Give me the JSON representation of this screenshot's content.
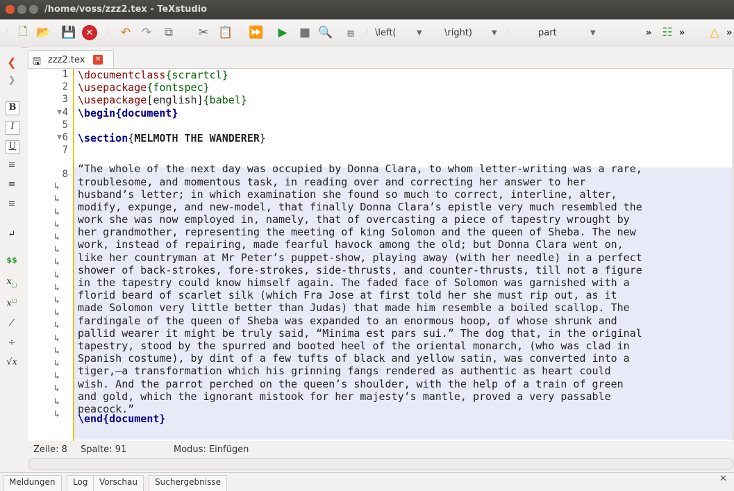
{
  "window": {
    "title": "/home/voss/zzz2.tex - TeXstudio"
  },
  "toolbar": {
    "left_delim": "\\left(",
    "right_delim": "\\right)",
    "structure_select": "part",
    "overflow": "»"
  },
  "tab": {
    "filename": "zzz2.tex"
  },
  "side_icons": {
    "bold": "B",
    "italic": "I",
    "underline": "U",
    "math": "$$"
  },
  "editor": {
    "line_numbers": [
      "1",
      "2",
      "3",
      "4",
      "5",
      "6",
      "7",
      "8"
    ],
    "line8_paragraph": [
      "“The whole of the next day was occupied by Donna Clara, to whom letter-writing was a rare,",
      "troublesome, and momentous task, in reading over and correcting her answer to her",
      "husband’s letter; in which examination she found so much to correct, interline, alter,",
      "modify, expunge, and new-model, that finally Donna Clara’s epistle very much resembled the",
      "work she was now employed in, namely, that of overcasting a piece of tapestry wrought by",
      "her grandmother, representing the meeting of king Solomon and the queen of Sheba. The new",
      "work, instead of repairing, made fearful havock among the old; but Donna Clara went on,",
      "like her countryman at Mr Peter’s puppet-show, playing away (with her needle) in a perfect",
      "shower of back-strokes, fore-strokes, side-thrusts, and counter-thrusts, till not a figure",
      "in the tapestry could know himself again. The faded face of Solomon was garnished with a",
      "florid beard of scarlet silk (which Fra Jose at first told her she must rip out, as it",
      "made Solomon very little better than Judas) that made him resemble a boiled scallop. The",
      "fardingale of the queen of Sheba was expanded to an enormous hoop, of whose shrunk and",
      "pallid wearer it might be truly said, “Minima est pars sui.” The dog that, in the original",
      "tapestry, stood by the spurred and booted heel of the oriental monarch, (who was clad in",
      "Spanish costume), by dint of a few tufts of black and yellow satin, was converted into a",
      "tiger,—a transformation which his grinning fangs rendered as authentic as heart could",
      "wish. And the parrot perched on the queen’s shoulder, with the help of a train of green",
      "and gold, which the ignorant mistook for her majesty’s mantle, proved a very passable",
      "peacock.”"
    ],
    "code": {
      "l1_cmd": "\\documentclass",
      "l1_arg": "{scrartcl}",
      "l2_cmd": "\\usepackage",
      "l2_arg": "{fontspec}",
      "l3_cmd": "\\usepackage",
      "l3_opt": "[english]",
      "l3_arg": "{babel}",
      "l4_cmd": "\\begin",
      "l4_arg": "{document}",
      "l6_cmd": "\\section",
      "l6_open": "{",
      "l6_title": "MELMOTH THE WANDERER",
      "l6_close": "}",
      "l9_cmd": "\\end{document}"
    }
  },
  "status": {
    "line": "Zeile: 8",
    "column": "Spalte: 91",
    "mode": "Modus: Einfügen"
  },
  "bottom_tabs": [
    "Meldungen",
    "Log",
    "Vorschau",
    "Suchergebnisse"
  ]
}
